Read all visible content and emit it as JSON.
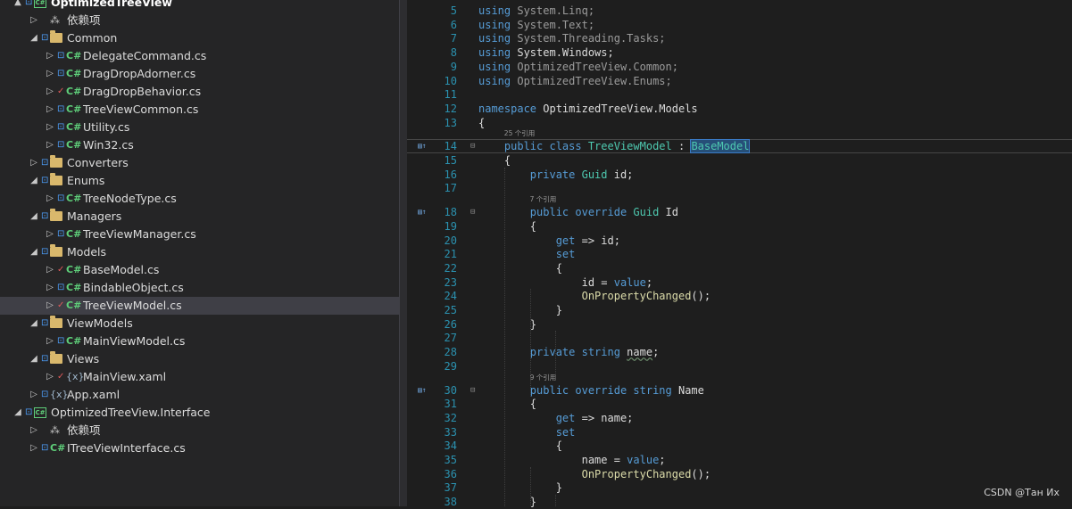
{
  "explorer": {
    "rows": [
      {
        "indent": 0,
        "arrow": "▲",
        "lock": true,
        "check": false,
        "kind": "proj",
        "label": "OptimizedTreeView",
        "bold": true,
        "selected": false
      },
      {
        "indent": 1,
        "arrow": "▷",
        "lock": false,
        "check": false,
        "kind": "refs",
        "label": "依赖项",
        "bold": false,
        "selected": false
      },
      {
        "indent": 1,
        "arrow": "◢",
        "lock": true,
        "check": false,
        "kind": "folder",
        "label": "Common",
        "bold": false,
        "selected": false
      },
      {
        "indent": 2,
        "arrow": "▷",
        "lock": true,
        "check": false,
        "kind": "cs",
        "label": "DelegateCommand.cs",
        "bold": false,
        "selected": false
      },
      {
        "indent": 2,
        "arrow": "▷",
        "lock": true,
        "check": false,
        "kind": "cs",
        "label": "DragDropAdorner.cs",
        "bold": false,
        "selected": false
      },
      {
        "indent": 2,
        "arrow": "▷",
        "lock": false,
        "check": true,
        "kind": "cs",
        "label": "DragDropBehavior.cs",
        "bold": false,
        "selected": false
      },
      {
        "indent": 2,
        "arrow": "▷",
        "lock": true,
        "check": false,
        "kind": "cs",
        "label": "TreeViewCommon.cs",
        "bold": false,
        "selected": false
      },
      {
        "indent": 2,
        "arrow": "▷",
        "lock": true,
        "check": false,
        "kind": "cs",
        "label": "Utility.cs",
        "bold": false,
        "selected": false
      },
      {
        "indent": 2,
        "arrow": "▷",
        "lock": true,
        "check": false,
        "kind": "cs",
        "label": "Win32.cs",
        "bold": false,
        "selected": false
      },
      {
        "indent": 1,
        "arrow": "▷",
        "lock": true,
        "check": false,
        "kind": "folder",
        "label": "Converters",
        "bold": false,
        "selected": false
      },
      {
        "indent": 1,
        "arrow": "◢",
        "lock": true,
        "check": false,
        "kind": "folder",
        "label": "Enums",
        "bold": false,
        "selected": false
      },
      {
        "indent": 2,
        "arrow": "▷",
        "lock": true,
        "check": false,
        "kind": "cs",
        "label": "TreeNodeType.cs",
        "bold": false,
        "selected": false
      },
      {
        "indent": 1,
        "arrow": "◢",
        "lock": true,
        "check": false,
        "kind": "folder",
        "label": "Managers",
        "bold": false,
        "selected": false
      },
      {
        "indent": 2,
        "arrow": "▷",
        "lock": true,
        "check": false,
        "kind": "cs",
        "label": "TreeViewManager.cs",
        "bold": false,
        "selected": false
      },
      {
        "indent": 1,
        "arrow": "◢",
        "lock": true,
        "check": false,
        "kind": "folder",
        "label": "Models",
        "bold": false,
        "selected": false
      },
      {
        "indent": 2,
        "arrow": "▷",
        "lock": false,
        "check": true,
        "kind": "cs",
        "label": "BaseModel.cs",
        "bold": false,
        "selected": false
      },
      {
        "indent": 2,
        "arrow": "▷",
        "lock": true,
        "check": false,
        "kind": "cs",
        "label": "BindableObject.cs",
        "bold": false,
        "selected": false
      },
      {
        "indent": 2,
        "arrow": "▷",
        "lock": false,
        "check": true,
        "kind": "cs",
        "label": "TreeViewModel.cs",
        "bold": false,
        "selected": true
      },
      {
        "indent": 1,
        "arrow": "◢",
        "lock": true,
        "check": false,
        "kind": "folder",
        "label": "ViewModels",
        "bold": false,
        "selected": false
      },
      {
        "indent": 2,
        "arrow": "▷",
        "lock": true,
        "check": false,
        "kind": "cs",
        "label": "MainViewModel.cs",
        "bold": false,
        "selected": false
      },
      {
        "indent": 1,
        "arrow": "◢",
        "lock": true,
        "check": false,
        "kind": "folder",
        "label": "Views",
        "bold": false,
        "selected": false
      },
      {
        "indent": 2,
        "arrow": "▷",
        "lock": false,
        "check": true,
        "kind": "xaml",
        "label": "MainView.xaml",
        "bold": false,
        "selected": false
      },
      {
        "indent": 1,
        "arrow": "▷",
        "lock": true,
        "check": false,
        "kind": "xaml",
        "label": "App.xaml",
        "bold": false,
        "selected": false
      },
      {
        "indent": 0,
        "arrow": "◢",
        "lock": true,
        "check": false,
        "kind": "proj",
        "label": "OptimizedTreeView.Interface",
        "bold": false,
        "selected": false
      },
      {
        "indent": 1,
        "arrow": "▷",
        "lock": false,
        "check": false,
        "kind": "refs",
        "label": "依赖项",
        "bold": false,
        "selected": false
      },
      {
        "indent": 1,
        "arrow": "▷",
        "lock": true,
        "check": false,
        "kind": "cs",
        "label": "ITreeViewInterface.cs",
        "bold": false,
        "selected": false
      }
    ],
    "icons": {
      "cs": "C#",
      "refs": "⁂",
      "xaml": "{x}",
      "proj": "C#",
      "lock": "🔒",
      "check": "✓"
    }
  },
  "editor": {
    "lines": [
      {
        "n": "5",
        "tokens": [
          [
            "kw-dim",
            "using "
          ],
          [
            "dim",
            "System.Linq;"
          ]
        ]
      },
      {
        "n": "6",
        "tokens": [
          [
            "kw-dim",
            "using "
          ],
          [
            "dim",
            "System.Text;"
          ]
        ]
      },
      {
        "n": "7",
        "tokens": [
          [
            "kw-dim",
            "using "
          ],
          [
            "dim",
            "System.Threading.Tasks;"
          ]
        ]
      },
      {
        "n": "8",
        "tokens": [
          [
            "kw",
            "using "
          ],
          [
            "plain",
            "System.Windows;"
          ]
        ]
      },
      {
        "n": "9",
        "tokens": [
          [
            "kw-dim",
            "using "
          ],
          [
            "dim",
            "OptimizedTreeView.Common;"
          ]
        ]
      },
      {
        "n": "10",
        "tokens": [
          [
            "kw-dim",
            "using "
          ],
          [
            "dim",
            "OptimizedTreeView.Enums;"
          ]
        ]
      },
      {
        "n": "11",
        "tokens": []
      },
      {
        "n": "12",
        "tokens": [
          [
            "kw",
            "namespace "
          ],
          [
            "plain",
            "OptimizedTreeView.Models"
          ]
        ]
      },
      {
        "n": "13",
        "tokens": [
          [
            "plain",
            "{"
          ]
        ]
      },
      {
        "n": "14",
        "lens": "25 个引用",
        "current": true,
        "glyph": "▤↑",
        "tokens": [
          [
            "plain",
            "    "
          ],
          [
            "kw",
            "public class "
          ],
          [
            "type",
            "TreeViewModel"
          ],
          [
            "plain",
            " : "
          ],
          [
            "hl",
            "BaseModel"
          ]
        ]
      },
      {
        "n": "15",
        "tokens": [
          [
            "plain",
            "    {"
          ]
        ]
      },
      {
        "n": "16",
        "tokens": [
          [
            "plain",
            "        "
          ],
          [
            "kw",
            "private "
          ],
          [
            "type",
            "Guid"
          ],
          [
            "plain",
            " id;"
          ]
        ]
      },
      {
        "n": "17",
        "tokens": []
      },
      {
        "n": "18",
        "lens": "7 个引用",
        "glyph": "▤↑",
        "tokens": [
          [
            "plain",
            "        "
          ],
          [
            "kw",
            "public override "
          ],
          [
            "type",
            "Guid"
          ],
          [
            "plain",
            " Id"
          ]
        ]
      },
      {
        "n": "19",
        "tokens": [
          [
            "plain",
            "        {"
          ]
        ]
      },
      {
        "n": "20",
        "tokens": [
          [
            "plain",
            "            "
          ],
          [
            "kw",
            "get "
          ],
          [
            "plain",
            "=> id;"
          ]
        ]
      },
      {
        "n": "21",
        "tokens": [
          [
            "plain",
            "            "
          ],
          [
            "kw",
            "set"
          ]
        ]
      },
      {
        "n": "22",
        "tokens": [
          [
            "plain",
            "            {"
          ]
        ]
      },
      {
        "n": "23",
        "tokens": [
          [
            "plain",
            "                id = "
          ],
          [
            "kw",
            "value"
          ],
          [
            "plain",
            ";"
          ]
        ]
      },
      {
        "n": "24",
        "tokens": [
          [
            "plain",
            "                "
          ],
          [
            "fn",
            "OnPropertyChanged"
          ],
          [
            "plain",
            "();"
          ]
        ]
      },
      {
        "n": "25",
        "tokens": [
          [
            "plain",
            "            }"
          ]
        ]
      },
      {
        "n": "26",
        "tokens": [
          [
            "plain",
            "        }"
          ]
        ]
      },
      {
        "n": "27",
        "tokens": []
      },
      {
        "n": "28",
        "tokens": [
          [
            "plain",
            "        "
          ],
          [
            "kw",
            "private string "
          ],
          [
            "sq",
            "name"
          ],
          [
            "plain",
            ";"
          ]
        ]
      },
      {
        "n": "29",
        "tokens": []
      },
      {
        "n": "30",
        "lens": "9 个引用",
        "glyph": "▤↑",
        "tokens": [
          [
            "plain",
            "        "
          ],
          [
            "kw",
            "public override string "
          ],
          [
            "plain",
            "Name"
          ]
        ]
      },
      {
        "n": "31",
        "tokens": [
          [
            "plain",
            "        {"
          ]
        ]
      },
      {
        "n": "32",
        "tokens": [
          [
            "plain",
            "            "
          ],
          [
            "kw",
            "get "
          ],
          [
            "plain",
            "=> name;"
          ]
        ]
      },
      {
        "n": "33",
        "tokens": [
          [
            "plain",
            "            "
          ],
          [
            "kw",
            "set"
          ]
        ]
      },
      {
        "n": "34",
        "tokens": [
          [
            "plain",
            "            {"
          ]
        ]
      },
      {
        "n": "35",
        "tokens": [
          [
            "plain",
            "                name = "
          ],
          [
            "kw",
            "value"
          ],
          [
            "plain",
            ";"
          ]
        ]
      },
      {
        "n": "36",
        "tokens": [
          [
            "plain",
            "                "
          ],
          [
            "fn",
            "OnPropertyChanged"
          ],
          [
            "plain",
            "();"
          ]
        ]
      },
      {
        "n": "37",
        "tokens": [
          [
            "plain",
            "            }"
          ]
        ]
      },
      {
        "n": "38",
        "tokens": [
          [
            "plain",
            "        }"
          ]
        ]
      }
    ]
  },
  "watermark": "CSDN @Тан Их"
}
